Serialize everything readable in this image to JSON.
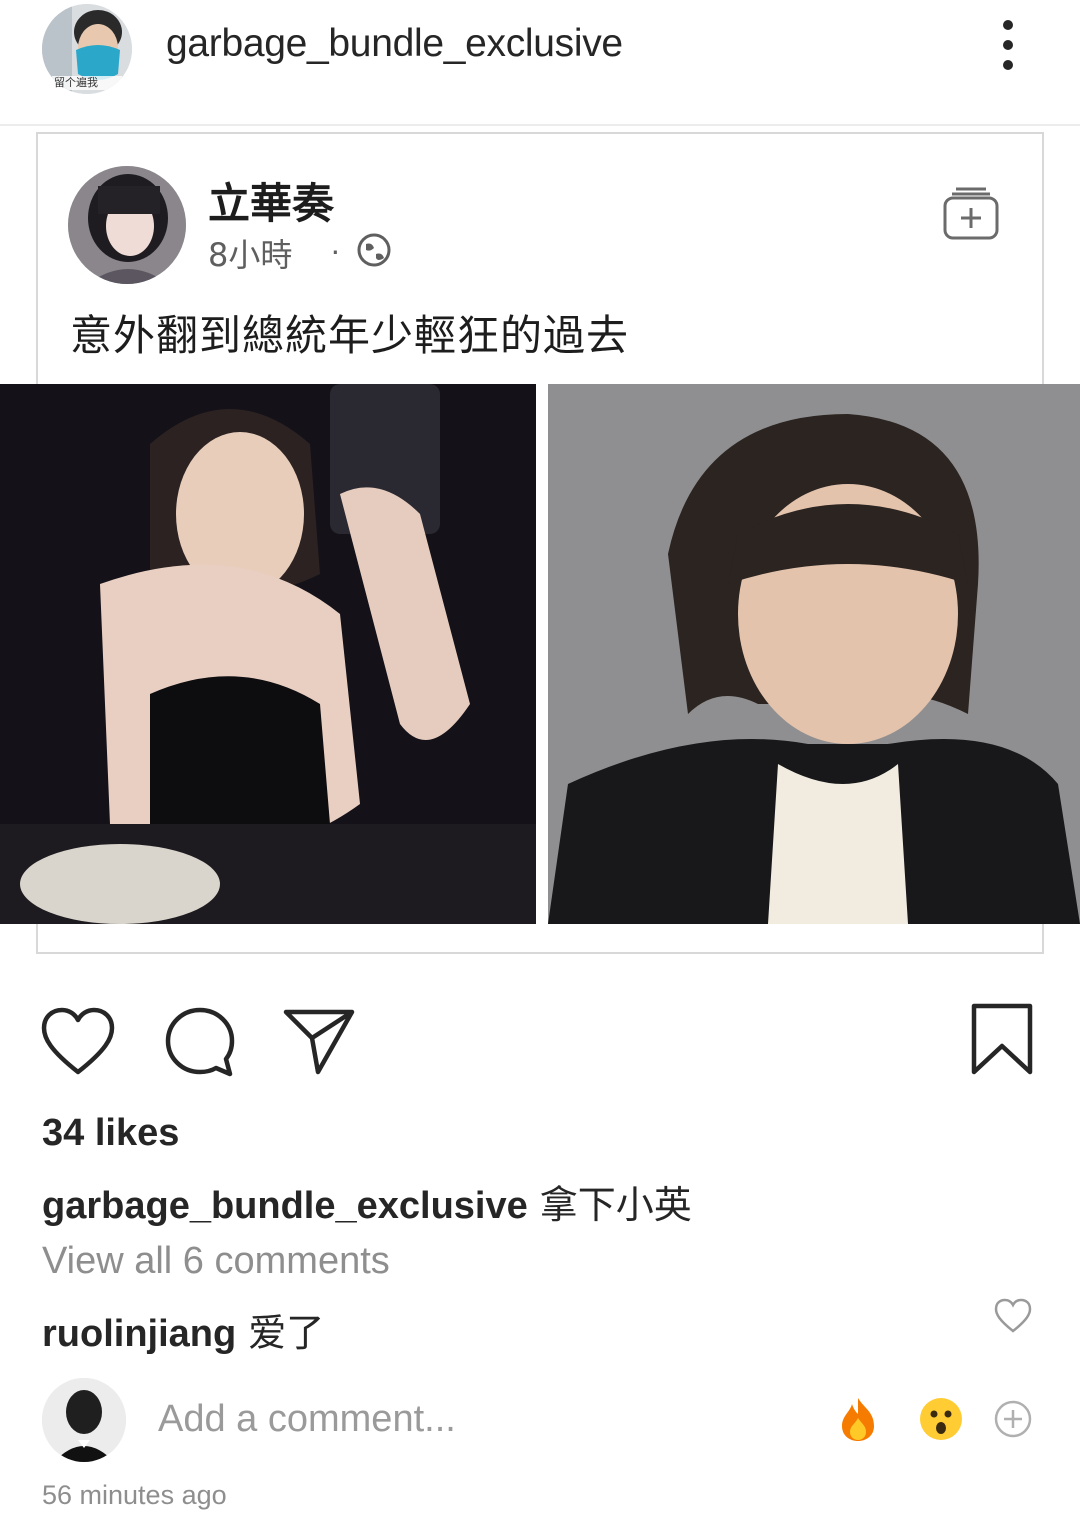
{
  "header": {
    "username": "garbage_bundle_exclusive",
    "avatar_badge": "留个遍我",
    "more_icon": "kebab-icon"
  },
  "embedded_post": {
    "author": "立華奏",
    "time": "8小時",
    "separator": "·",
    "privacy_icon": "globe-icon",
    "save_icon": "save-to-collection-icon",
    "text": "意外翻到總統年少輕狂的過去"
  },
  "actions": {
    "like_icon": "heart-icon",
    "comment_icon": "comment-icon",
    "share_icon": "send-icon",
    "save_icon": "bookmark-icon"
  },
  "likes": "34 likes",
  "caption": {
    "username": "garbage_bundle_exclusive",
    "text": "拿下小英"
  },
  "view_all": "View all 6 comments",
  "comment": {
    "username": "ruolinjiang",
    "text": "爱了"
  },
  "add_comment": {
    "placeholder": "Add a comment...",
    "quick_reactions": [
      "fire-emoji",
      "wow-emoji",
      "add-icon"
    ]
  },
  "timestamp": "56 minutes ago",
  "colors": {
    "text": "#262626",
    "muted": "#8e8e8e",
    "border": "#d8d8d8"
  }
}
